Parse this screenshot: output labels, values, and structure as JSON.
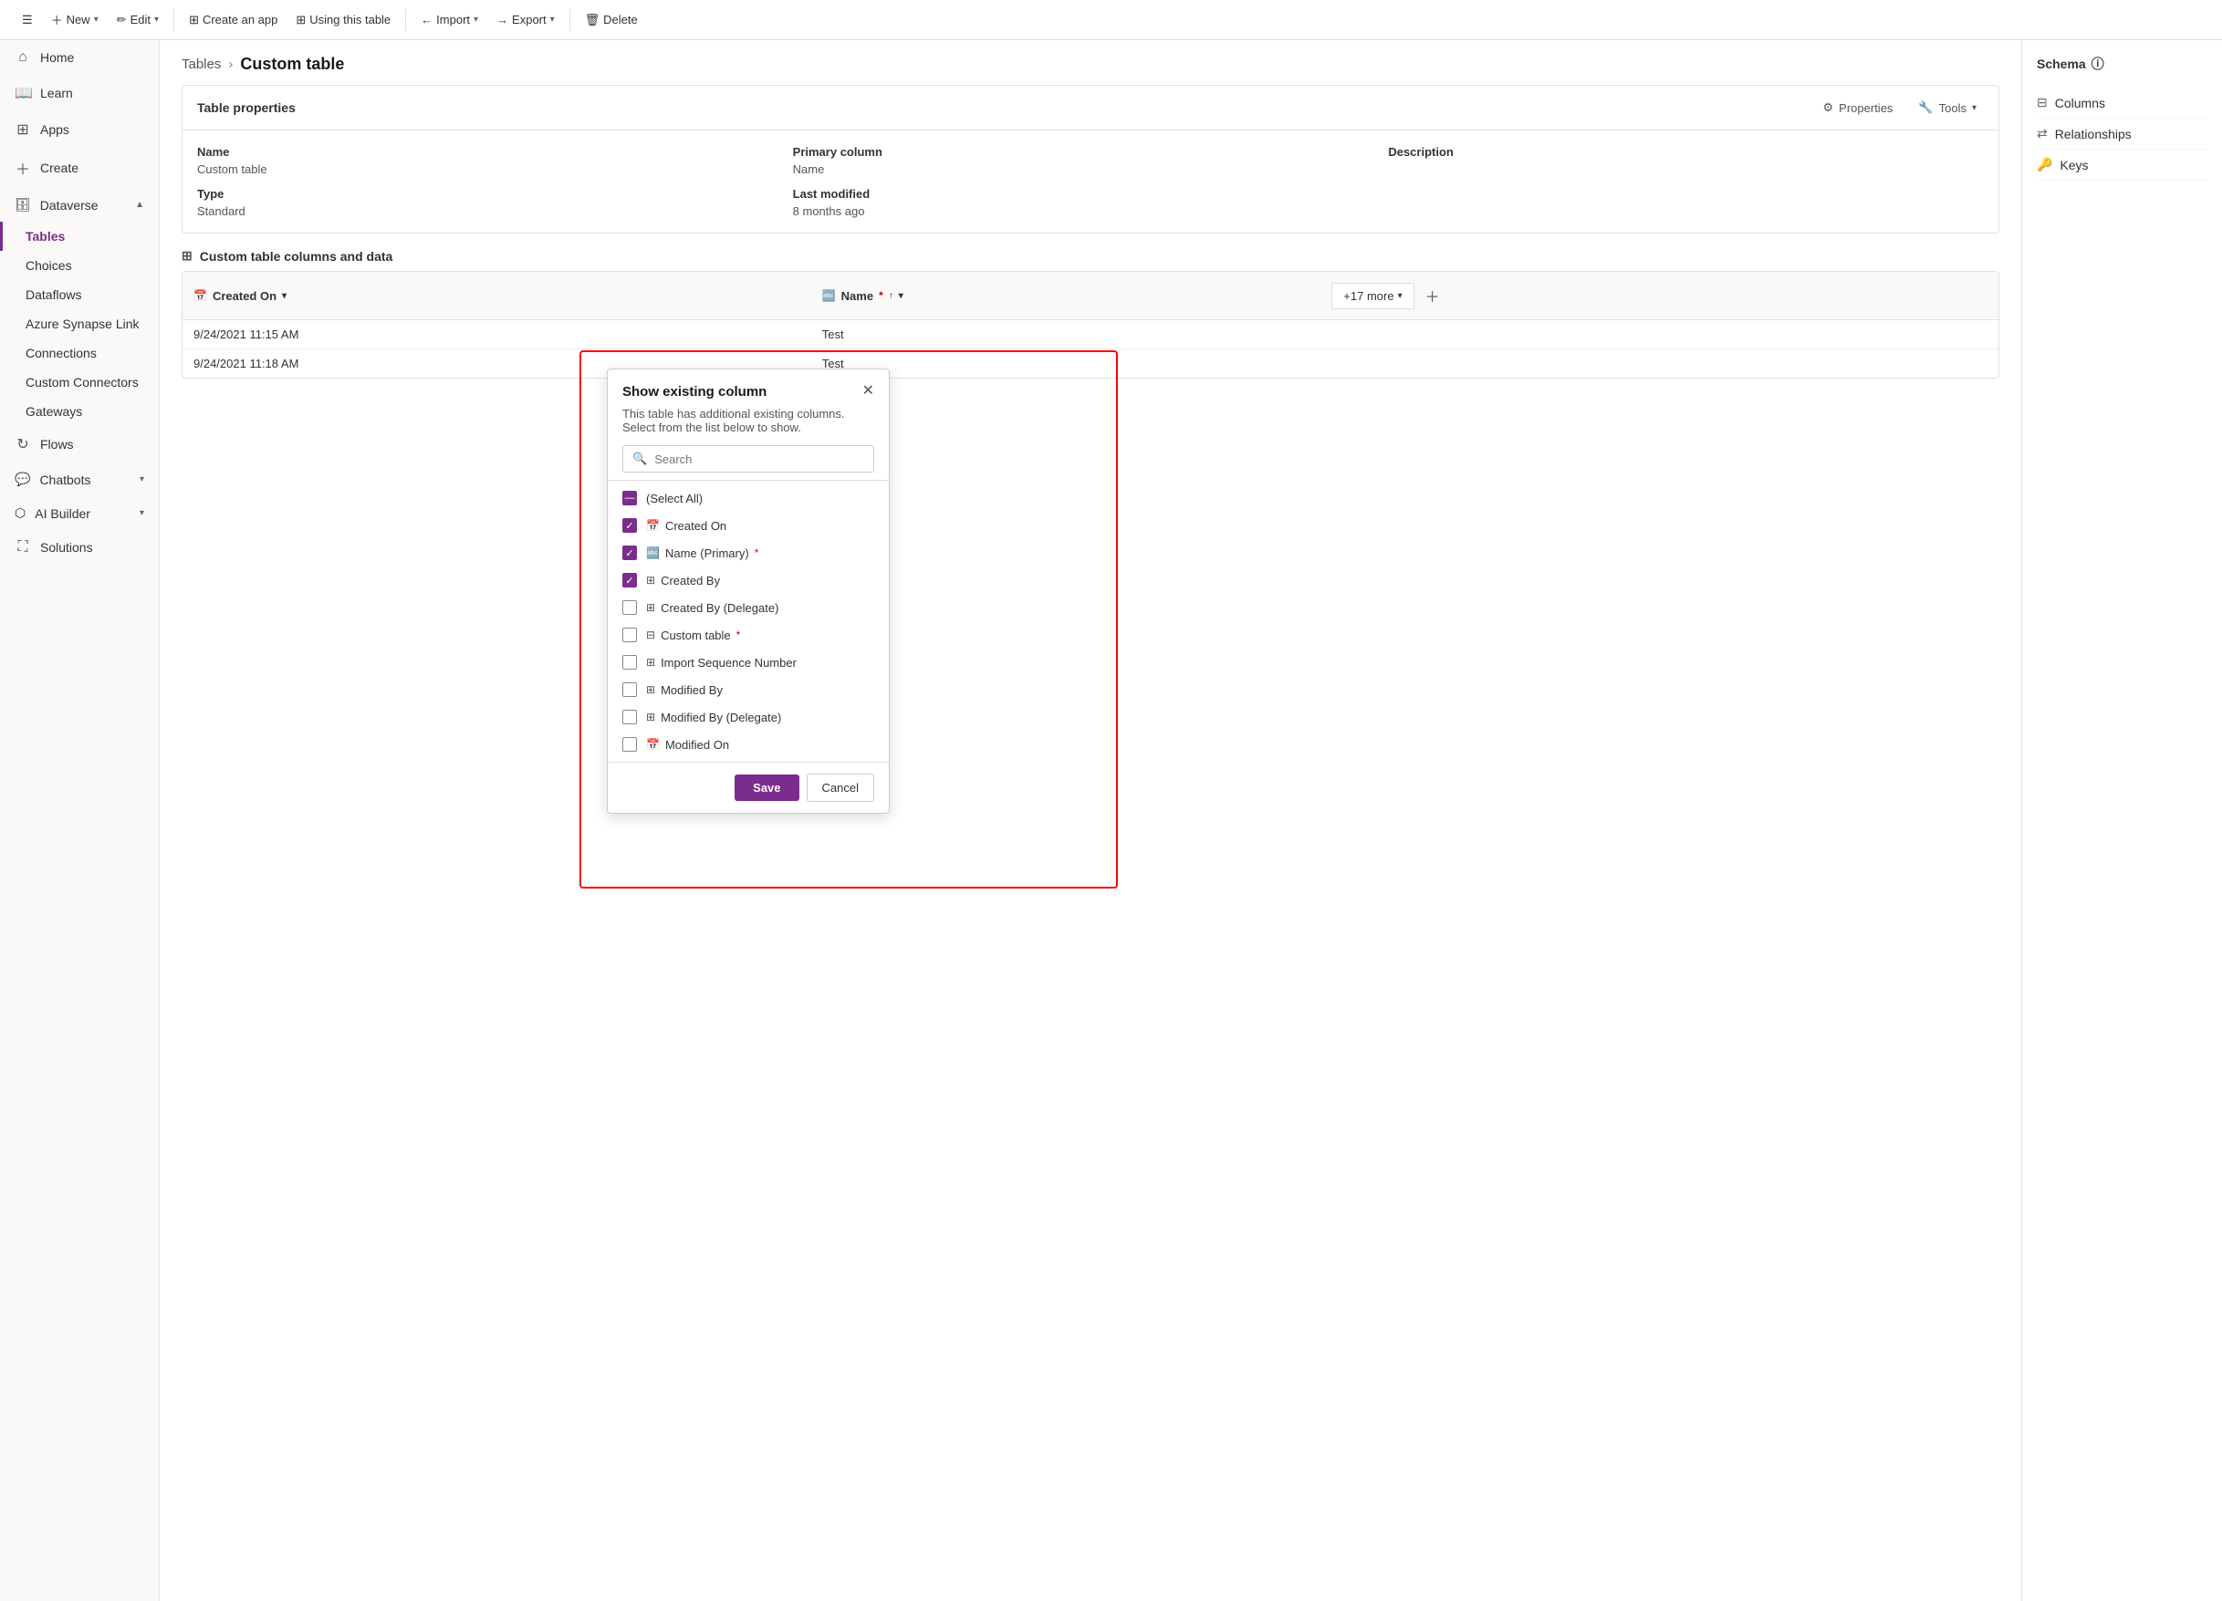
{
  "toolbar": {
    "hamburger": "☰",
    "new_label": "New",
    "edit_label": "Edit",
    "create_app_label": "Create an app",
    "using_table_label": "Using this table",
    "import_label": "Import",
    "export_label": "Export",
    "delete_label": "Delete"
  },
  "sidebar": {
    "home_label": "Home",
    "learn_label": "Learn",
    "apps_label": "Apps",
    "create_label": "Create",
    "dataverse_label": "Dataverse",
    "tables_label": "Tables",
    "choices_label": "Choices",
    "dataflows_label": "Dataflows",
    "azure_synapse_label": "Azure Synapse Link",
    "connections_label": "Connections",
    "custom_connectors_label": "Custom Connectors",
    "gateways_label": "Gateways",
    "flows_label": "Flows",
    "chatbots_label": "Chatbots",
    "ai_builder_label": "AI Builder",
    "solutions_label": "Solutions"
  },
  "breadcrumb": {
    "parent": "Tables",
    "current": "Custom table"
  },
  "table_properties": {
    "section_title": "Table properties",
    "properties_btn": "Properties",
    "tools_btn": "Tools",
    "col_name": "Name",
    "col_primary_column": "Primary column",
    "col_description": "Description",
    "name_value": "Custom table",
    "primary_value": "Name",
    "description_value": "",
    "col_type": "Type",
    "col_last_modified": "Last modified",
    "type_value": "Standard",
    "last_modified_value": "8 months ago"
  },
  "data_section": {
    "title": "Custom table columns and data",
    "col_created_on": "Created On",
    "col_name": "Name",
    "col_sort": "↑",
    "more_cols_label": "+17 more",
    "rows": [
      {
        "created_on": "9/24/2021 11:15 AM",
        "name": "Test"
      },
      {
        "created_on": "9/24/2021 11:18 AM",
        "name": "Test"
      }
    ]
  },
  "schema": {
    "title": "Schema",
    "info_icon": "ⓘ",
    "columns_label": "Columns",
    "relationships_label": "Relationships",
    "keys_label": "Keys"
  },
  "dialog": {
    "title": "Show existing column",
    "subtitle": "This table has additional existing columns. Select from the list below to show.",
    "search_placeholder": "Search",
    "items": [
      {
        "label": "(Select All)",
        "checked": "partial",
        "icon": "",
        "required": false
      },
      {
        "label": "Created On",
        "checked": "checked",
        "icon": "📅",
        "required": false
      },
      {
        "label": "Name (Primary)",
        "checked": "checked",
        "icon": "🔤",
        "required": true
      },
      {
        "label": "Created By",
        "checked": "checked",
        "icon": "⊞",
        "required": false
      },
      {
        "label": "Created By (Delegate)",
        "checked": "unchecked",
        "icon": "⊞",
        "required": false
      },
      {
        "label": "Custom table",
        "checked": "unchecked",
        "icon": "⊟",
        "required": true
      },
      {
        "label": "Import Sequence Number",
        "checked": "unchecked",
        "icon": "⊞",
        "required": false
      },
      {
        "label": "Modified By",
        "checked": "unchecked",
        "icon": "⊞",
        "required": false
      },
      {
        "label": "Modified By (Delegate)",
        "checked": "unchecked",
        "icon": "⊞",
        "required": false
      },
      {
        "label": "Modified On",
        "checked": "unchecked",
        "icon": "📅",
        "required": false
      }
    ],
    "save_label": "Save",
    "cancel_label": "Cancel"
  },
  "colors": {
    "accent": "#7b2d8b",
    "border_red": "red"
  }
}
